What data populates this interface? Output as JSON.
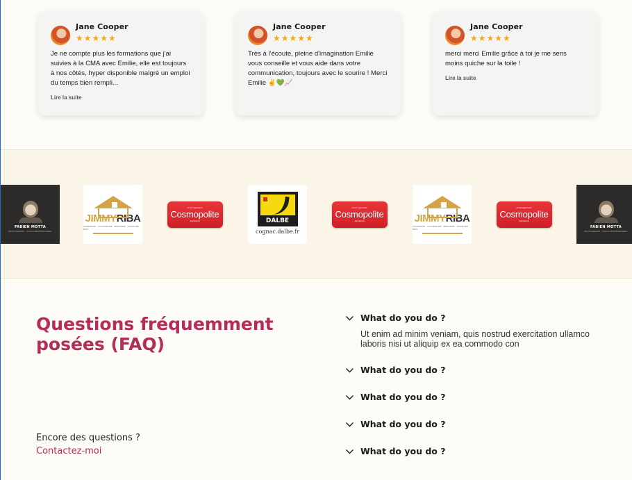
{
  "reviews": [
    {
      "name": "Jane Cooper",
      "stars": "★★★★★",
      "text": "Je ne compte plus les formations que j'ai suivies à la CMA avec Emilie, elle est toujours à nos côtés, hyper disponible malgré un emploi du temps bien rempli...",
      "read_more": "Lire la suite"
    },
    {
      "name": "Jane Cooper",
      "stars": "★★★★★",
      "text": "Très à l'écoute, pleine d'imagination Emilie vous conseille et vous aide dans votre communication, toujours avec le sourire ! Merci Emilie ✌💚📈",
      "read_more": ""
    },
    {
      "name": "Jane Cooper",
      "stars": "★★★★★",
      "text": "merci merci Emilie grâce à toi je me sens moins quiche sur la toile !",
      "read_more": "Lire la suite"
    }
  ],
  "logos": {
    "fabien": {
      "name": "FABIEN MOTTA",
      "sub": "PHOTOGRAPHE · COACH PROFESSIONNEL"
    },
    "jimmy": {
      "word1": "JIMMY",
      "word2": "RIBA",
      "sub": "CHARPENTE · COUVERTURE · ZINGUERIE · OSSATURE BOIS"
    },
    "cosmo": {
      "top": "Aménagement",
      "name": "Cosmopolite",
      "bottom": "Aquitaine"
    },
    "dalbe": {
      "word": "DALBE",
      "url": "cognac.dalbe.fr"
    }
  },
  "faq": {
    "title": "Questions fréquemment posées (FAQ)",
    "more": "Encore des questions ?",
    "contact": "Contactez-moi",
    "items": [
      {
        "q": "What do you do ?",
        "a": "Ut enim ad minim veniam, quis nostrud exercitation ullamco laboris nisi ut aliquip ex ea commodo con"
      },
      {
        "q": "What do you do ?"
      },
      {
        "q": "What do you do ?"
      },
      {
        "q": "What do you do ?"
      },
      {
        "q": "What do you do ?"
      }
    ]
  },
  "icons": {
    "chevron": "chevron-down-icon",
    "star": "star-icon"
  },
  "colors": {
    "accent": "#b42c5a",
    "star": "#f0a91c",
    "cosmo_red": "#d92a2f",
    "jimmy_gold": "#d4a548"
  }
}
